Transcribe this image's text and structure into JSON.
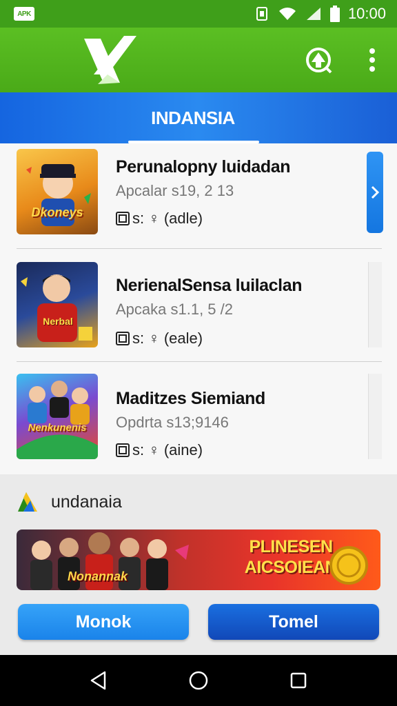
{
  "status_bar": {
    "badge": "APK",
    "time": "10:00"
  },
  "app_bar": {
    "logo_icon": "x-logo-icon",
    "action_icons": [
      "upload-circle-icon",
      "more-vert-icon"
    ]
  },
  "tabs": [
    {
      "label": "INDANSIA",
      "selected": true
    }
  ],
  "list": {
    "items": [
      {
        "title": "Perunalopny luidadan",
        "subtitle": "Apcalar s19, 2 13",
        "meta": "s: ♀ (adle)",
        "thumb_text": "Dkoneys"
      },
      {
        "title": "NerienalSensa luilaclan",
        "subtitle": "Apcaka s1.1, 5 /2",
        "meta": "s: ♀ (eale)",
        "thumb_text": "Nerbal"
      },
      {
        "title": "Maditzes Siemiand",
        "subtitle": "Opdrta s13;9146",
        "meta": "s: ♀ (aine)",
        "thumb_text": "Nenkunenis"
      }
    ]
  },
  "section": {
    "title": "undanaia",
    "banner_text": "PLINESEN AICSOIEAN",
    "banner_logo": "Nonannak"
  },
  "buttons": {
    "left": "Monok",
    "right": "Tomel"
  },
  "colors": {
    "app_bar": "#4aaa18",
    "tab_bar": "#1a6fe0",
    "accent_blue": "#1a83ea",
    "banner_yellow": "#ffe04a"
  }
}
